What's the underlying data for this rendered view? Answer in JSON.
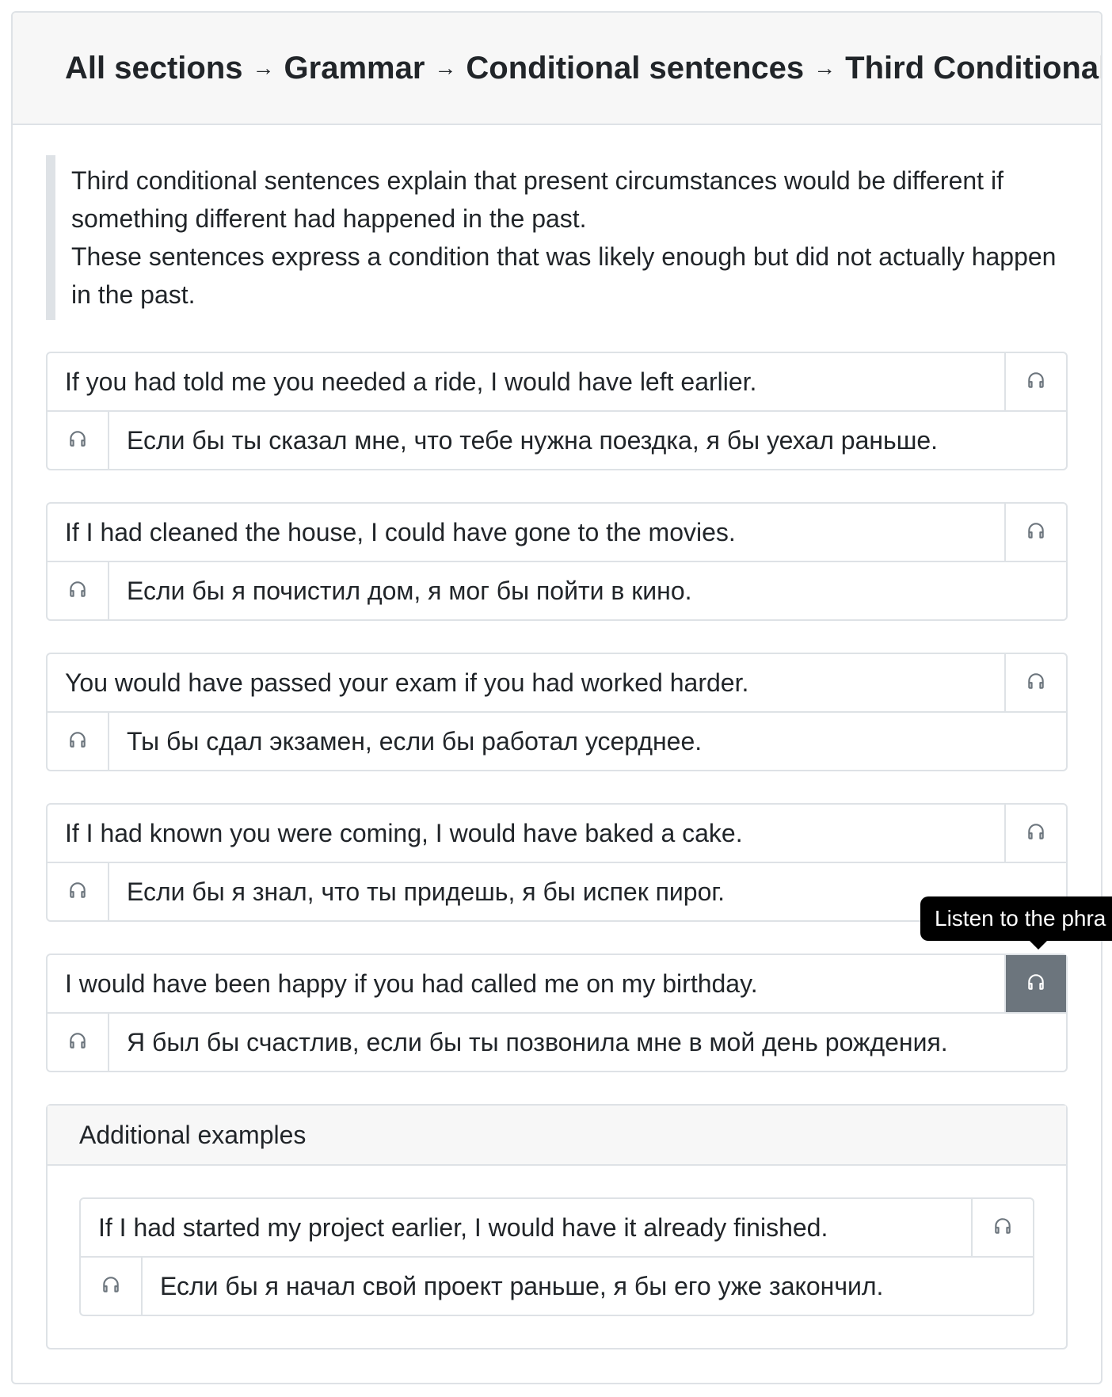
{
  "breadcrumb": {
    "items": [
      "All sections",
      "Grammar",
      "Conditional sentences",
      "Third Conditional"
    ],
    "separator": "→"
  },
  "intro": {
    "line1": "Third conditional sentences explain that present circumstances would be different if something different had happened in the past.",
    "line2": "These sentences express a condition that was likely enough but did not actually happen in the past."
  },
  "phrases": [
    {
      "en": "If you had told me you needed a ride, I would have left earlier.",
      "ru": "Если бы ты сказал мне, что тебе нужна поездка, я бы уехал раньше."
    },
    {
      "en": "If I had cleaned the house, I could have gone to the movies.",
      "ru": "Если бы я почистил дом, я мог бы пойти в кино."
    },
    {
      "en": "You would have passed your exam if you had worked harder.",
      "ru": "Ты бы сдал экзамен, если бы работал усерднее."
    },
    {
      "en": "If I had known you were coming, I would have baked a cake.",
      "ru": "Если бы я знал, что ты придешь, я бы испек пирог."
    },
    {
      "en": "I would have been happy if you had called me on my birthday.",
      "ru": "Я был бы счастлив, если бы ты позвонила мне в мой день рождения."
    }
  ],
  "tooltip": {
    "text": "Listen to the phra"
  },
  "additional": {
    "title": "Additional examples",
    "phrases": [
      {
        "en": "If I had started my project earlier, I would have it already finished.",
        "ru": "Если бы я начал свой проект раньше, я бы его уже закончил."
      }
    ]
  },
  "icons": {
    "listen": "headphones-icon"
  },
  "colors": {
    "active_button": "#6c757d",
    "border": "#dee2e6",
    "header_bg": "#f7f7f7",
    "tooltip_bg": "#000000"
  }
}
